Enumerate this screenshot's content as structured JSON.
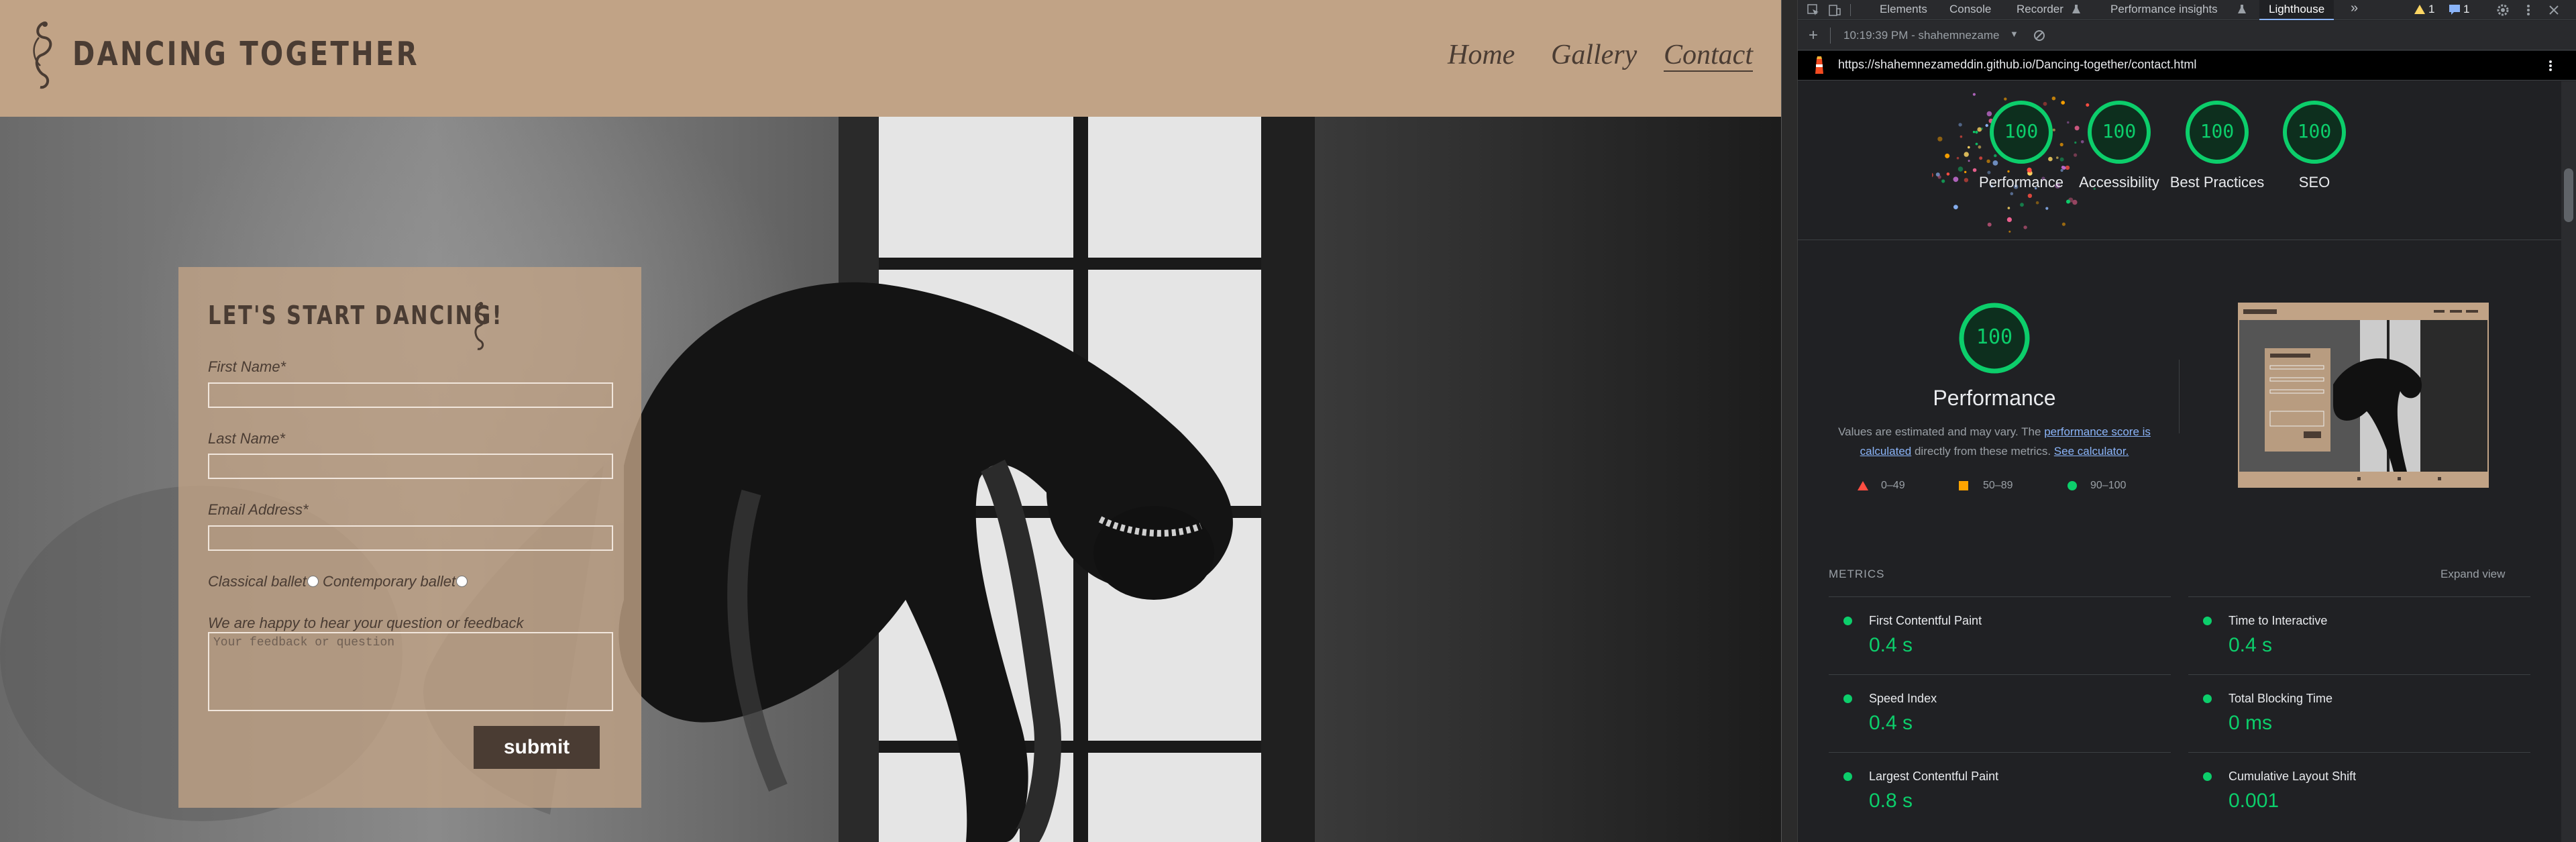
{
  "site": {
    "title": "DANCING TOGETHER",
    "nav": [
      "Home",
      "Gallery",
      "Contact"
    ],
    "form": {
      "heading": "LET'S START DANCING!",
      "first_name_label": "First Name*",
      "last_name_label": "Last Name*",
      "email_label": "Email Address*",
      "radio_classical": "Classical ballet",
      "radio_contemporary": "Contemporary ballet",
      "feedback_label": "We are happy to hear your question or feedback",
      "feedback_placeholder": "Your feedback or question",
      "submit_label": "submit"
    },
    "colors": {
      "header_bg": "#c1a386",
      "text": "#4a3c33",
      "button_bg": "#4a3c33"
    }
  },
  "devtools": {
    "tabs": [
      "Elements",
      "Console",
      "Recorder",
      "Performance insights",
      "Lighthouse"
    ],
    "active_tab": "Lighthouse",
    "warning_count": "1",
    "message_count": "1",
    "report_time": "10:19:39 PM - shahemnezame",
    "url": "https://shahemnezameddin.github.io/Dancing-together/contact.html",
    "scores": [
      {
        "label": "Performance",
        "value": "100"
      },
      {
        "label": "Accessibility",
        "value": "100"
      },
      {
        "label": "Best Practices",
        "value": "100"
      },
      {
        "label": "SEO",
        "value": "100"
      }
    ],
    "performance": {
      "score": "100",
      "title": "Performance",
      "desc_pre": "Values are estimated and may vary. The ",
      "desc_link1": "performance score is calculated",
      "desc_mid": " directly from these metrics. ",
      "desc_link2": "See calculator.",
      "legend": [
        "0–49",
        "50–89",
        "90–100"
      ]
    },
    "metrics_title": "METRICS",
    "expand_view": "Expand view",
    "metrics": [
      {
        "name": "First Contentful Paint",
        "value": "0.4 s"
      },
      {
        "name": "Time to Interactive",
        "value": "0.4 s"
      },
      {
        "name": "Speed Index",
        "value": "0.4 s"
      },
      {
        "name": "Total Blocking Time",
        "value": "0 ms"
      },
      {
        "name": "Largest Contentful Paint",
        "value": "0.8 s"
      },
      {
        "name": "Cumulative Layout Shift",
        "value": "0.001"
      }
    ],
    "colors": {
      "pass": "#0cce6b",
      "average": "#ffa400",
      "fail": "#ff4e42",
      "link": "#8ab4f8"
    }
  }
}
